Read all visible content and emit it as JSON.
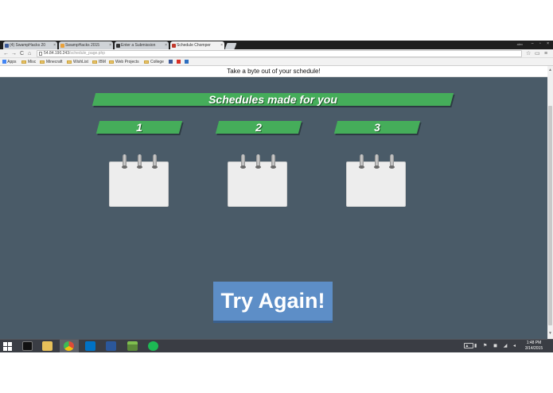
{
  "browser": {
    "tabs": [
      {
        "label": "(4) SwampHacks 20",
        "favicon_color": "#3b5998",
        "active": false
      },
      {
        "label": "SwampHacks 2015",
        "favicon_color": "#e9a13a",
        "active": false
      },
      {
        "label": "Enter a Submission",
        "favicon_color": "#333333",
        "active": false
      },
      {
        "label": "Schedule Chomper",
        "favicon_color": "#c0392b",
        "active": true
      }
    ],
    "tab_close": "×",
    "user": "alex",
    "window_controls": "– ▫ ×",
    "nav": {
      "back": "←",
      "forward": "→",
      "reload": "C",
      "home": "⌂"
    },
    "url_host": "54.84.190.243",
    "url_path": "/schedule_page.php",
    "star": "☆",
    "menu": "≡",
    "bookmarks": [
      {
        "label": "Apps",
        "kind": "apps"
      },
      {
        "label": "Misc",
        "kind": "folder"
      },
      {
        "label": "Minecraft",
        "kind": "folder"
      },
      {
        "label": "WishList",
        "kind": "folder"
      },
      {
        "label": "IBM",
        "kind": "folder"
      },
      {
        "label": "Web Projects",
        "kind": "folder"
      },
      {
        "label": "College",
        "kind": "folder"
      }
    ]
  },
  "page": {
    "header": "Take a byte out of your schedule!",
    "title": "Schedules made for you",
    "schedules": [
      {
        "number": "1"
      },
      {
        "number": "2"
      },
      {
        "number": "3"
      }
    ],
    "button": "Try Again!",
    "colors": {
      "background": "#4a5b68",
      "banner": "#45ad5a",
      "button": "#5d8ec7"
    }
  },
  "taskbar": {
    "apps": [
      {
        "name": "start-button"
      },
      {
        "name": "cmd",
        "color": "#111111"
      },
      {
        "name": "file-explorer",
        "color": "#e8c15a"
      },
      {
        "name": "chrome",
        "color": "#dd4b39"
      },
      {
        "name": "outlook",
        "color": "#0072c6"
      },
      {
        "name": "word",
        "color": "#2b579a"
      },
      {
        "name": "minecraft",
        "color": "#5b8a3a"
      },
      {
        "name": "spotify",
        "color": "#1db954"
      }
    ],
    "clock_time": "1:48 PM",
    "clock_date": "3/14/2015"
  }
}
